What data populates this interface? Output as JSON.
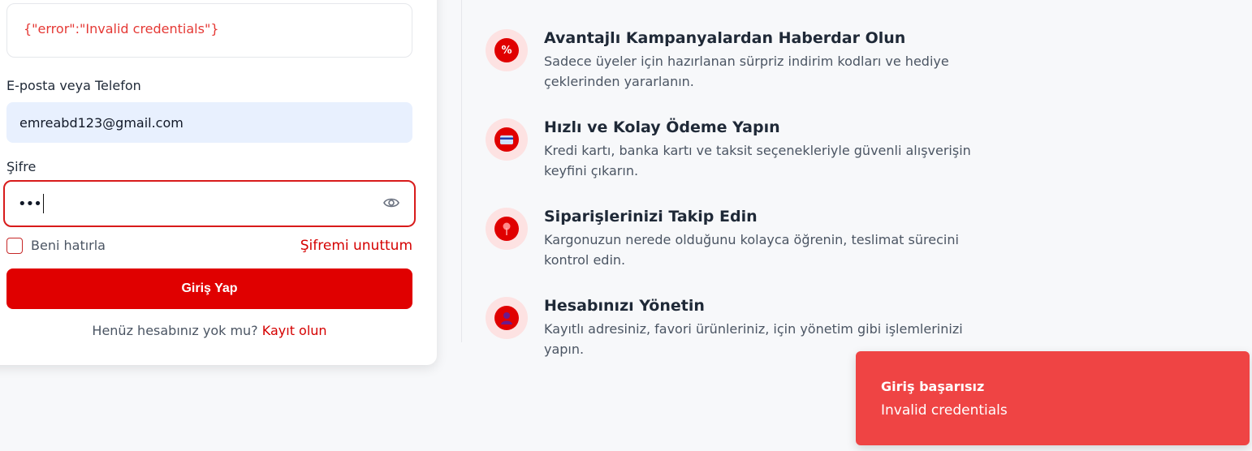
{
  "login": {
    "error_text": "{\"error\":\"Invalid credentials\"}",
    "email_label": "E-posta veya Telefon",
    "email_value": "emreabd123@gmail.com",
    "password_label": "Şifre",
    "password_masked": "•••",
    "remember_label": "Beni hatırla",
    "forgot_label": "Şifremi unuttum",
    "submit_label": "Giriş Yap",
    "signup_prompt": "Henüz hesabınız yok mu?",
    "signup_link": "Kayıt olun"
  },
  "features": [
    {
      "icon": "percent-icon",
      "icon_text": "%",
      "title": "Avantajlı Kampanyalardan Haberdar Olun",
      "desc": "Sadece üyeler için hazırlanan sürpriz indirim kodları ve hediye çeklerinden yararlanın."
    },
    {
      "icon": "credit-card-icon",
      "icon_text": "",
      "title": "Hızlı ve Kolay Ödeme Yapın",
      "desc": "Kredi kartı, banka kartı ve taksit seçenekleriyle güvenli alışverişin keyfini çıkarın."
    },
    {
      "icon": "location-pin-icon",
      "icon_text": "",
      "title": "Siparişlerinizi Takip Edin",
      "desc": "Kargonuzun nerede olduğunu kolayca öğrenin, teslimat sürecini kontrol edin."
    },
    {
      "icon": "user-icon",
      "icon_text": "",
      "title": "Hesabınızı Yönetin",
      "desc": "Kayıtlı adresiniz, favori ürünleriniz, için yönetim gibi işlemlerinizi yapın."
    }
  ],
  "toast": {
    "title": "Giriş başarısız",
    "message": "Invalid credentials"
  },
  "colors": {
    "brand": "#e00000",
    "toast_bg": "#ef4444",
    "error_text": "#e53935",
    "icon_bg": "#fde2e2"
  }
}
